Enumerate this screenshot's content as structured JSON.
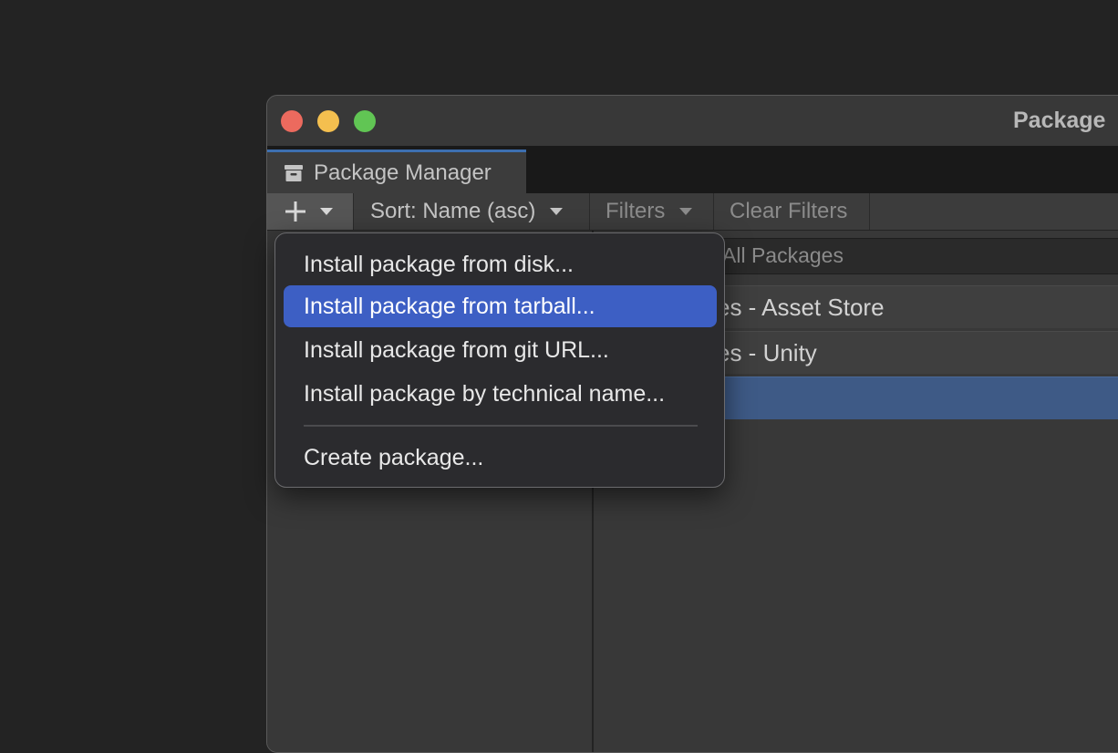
{
  "window": {
    "title": "Package",
    "traffic_lights": [
      "close",
      "minimize",
      "zoom"
    ]
  },
  "tab": {
    "label": "Package Manager",
    "icon": "package-box-icon"
  },
  "toolbar": {
    "add_icon": "plus-icon",
    "sort_label": "Sort: Name (asc)",
    "filters_label": "Filters",
    "clear_filters_label": "Clear Filters"
  },
  "search_row": {
    "text": "All Packages"
  },
  "list": [
    {
      "label": "es - Asset Store"
    },
    {
      "label": "es - Unity"
    },
    {
      "label": ""
    }
  ],
  "add_menu": {
    "items": [
      {
        "label": "Install package from disk..."
      },
      {
        "label": "Install package from tarball...",
        "highlighted": true
      },
      {
        "label": "Install package from git URL..."
      },
      {
        "label": "Install package by technical name..."
      },
      {
        "label": "Create package..."
      }
    ],
    "highlight_color": "#3d5fc4"
  },
  "colors": {
    "background": "#232323",
    "panel": "#383838",
    "accent": "#3d6fb0",
    "selected_row": "#3e5a86"
  }
}
